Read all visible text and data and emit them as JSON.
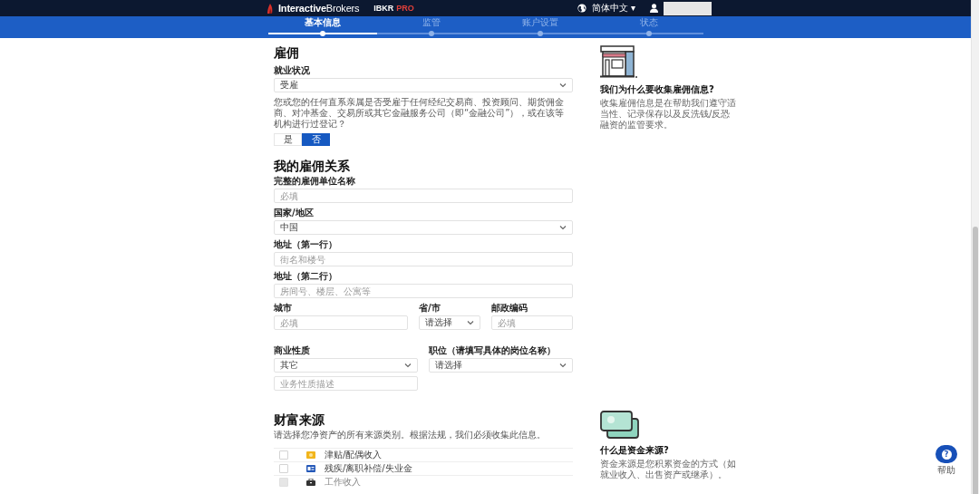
{
  "header": {
    "logo": "**Interactive**Brokers",
    "product": "IBKR",
    "product_tier": "PRO",
    "language": "简体中文",
    "language_caret": "▾"
  },
  "steps": [
    {
      "label": "基本信息",
      "selected": true
    },
    {
      "label": "监管",
      "selected": false
    },
    {
      "label": "账户设置",
      "selected": false
    },
    {
      "label": "状态",
      "selected": false
    }
  ],
  "employment": {
    "title": "雇佣",
    "status_label": "就业状况",
    "status_value": "受雇",
    "question": "您或您的任何直系亲属是否受雇于任何经纪交易商、投资顾问、期货佣金商、对冲基金、交易所或其它金融服务公司（即“金融公司”），或在该等机构进行过登记？",
    "options": [
      {
        "label": "是",
        "selected": false
      },
      {
        "label": "否",
        "selected": true
      }
    ]
  },
  "employer": {
    "title": "我的雇佣关系",
    "rows": [
      [
        {
          "kind": "input",
          "label": "完整的雇佣单位名称",
          "placeholder": "必填"
        }
      ],
      [
        {
          "kind": "select",
          "label": "国家/地区",
          "value": "中国"
        }
      ],
      [
        {
          "kind": "input",
          "label": "地址（第一行）",
          "placeholder": "街名和楼号"
        }
      ],
      [
        {
          "kind": "input",
          "label": "地址（第二行）",
          "placeholder": "房间号、楼层、公寓等"
        }
      ],
      [
        {
          "kind": "input",
          "label": "城市",
          "placeholder": "必填"
        },
        {
          "kind": "select",
          "label": "省/市",
          "value": "请选择"
        },
        {
          "kind": "input",
          "label": "邮政编码",
          "placeholder": "必填"
        }
      ],
      [
        {
          "kind": "select",
          "label": "商业性质",
          "value": "其它",
          "extra": {
            "kind": "input",
            "placeholder": "业务性质描述"
          }
        },
        {
          "kind": "select",
          "label": "职位（请填写具体的岗位名称）",
          "value": "请选择"
        }
      ]
    ]
  },
  "wealth": {
    "title": "财富来源",
    "description": "请选择您净资产的所有来源类别。根据法规，我们必须收集此信息。",
    "sources": [
      {
        "label": "津贴/配偶收入",
        "checked": false,
        "disabled": false
      },
      {
        "label": "残疾/离职补偿/失业金",
        "checked": false,
        "disabled": false
      },
      {
        "label": "工作收入",
        "checked": false,
        "disabled": true
      }
    ]
  },
  "info_cards": [
    {
      "title": "我们为什么要收集雇佣信息?",
      "text": "收集雇佣信息是在帮助我们遵守适当性、记录保存以及反洗钱/反恐融资的监管要求。"
    },
    {
      "title": "什么是资金来源?",
      "text": "资金来源是您积累资金的方式（如就业收入、出售资产或继承）。"
    }
  ],
  "help": {
    "icon": "?",
    "label": "帮助"
  }
}
